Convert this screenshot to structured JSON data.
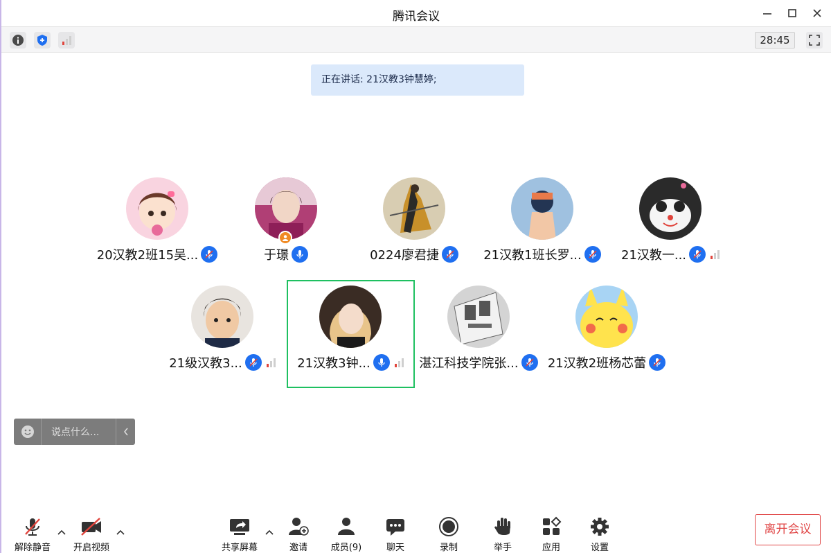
{
  "window": {
    "title": "腾讯会议"
  },
  "infobar": {
    "timer": "28:45"
  },
  "speaking_banner": "正在讲话: 21汉教3钟慧婷;",
  "participants": [
    {
      "name": "20汉教2班15吴...",
      "mic": "muted"
    },
    {
      "name": "于璟",
      "mic": "on",
      "host": true
    },
    {
      "name": "0224廖君捷",
      "mic": "muted"
    },
    {
      "name": "21汉教1班长罗...",
      "mic": "muted"
    },
    {
      "name": "21汉教一...",
      "mic": "muted",
      "signal": true
    },
    {
      "name": "21级汉教3...",
      "mic": "muted",
      "signal": true
    },
    {
      "name": "21汉教3钟...",
      "mic": "on",
      "signal": true,
      "active": true
    },
    {
      "name": "湛江科技学院张...",
      "mic": "muted"
    },
    {
      "name": "21汉教2班杨芯蕾",
      "mic": "muted"
    }
  ],
  "chat": {
    "placeholder": "说点什么..."
  },
  "toolbar": {
    "unmute": "解除静音",
    "video": "开启视频",
    "share": "共享屏幕",
    "invite": "邀请",
    "members": "成员(9)",
    "chat": "聊天",
    "record": "录制",
    "raise_hand": "举手",
    "apps": "应用",
    "settings": "设置",
    "leave": "离开会议"
  },
  "colors": {
    "accent": "#1f6ff0",
    "active_border": "#1ec060",
    "leave": "#e04646",
    "banner": "#dbe9fb"
  }
}
